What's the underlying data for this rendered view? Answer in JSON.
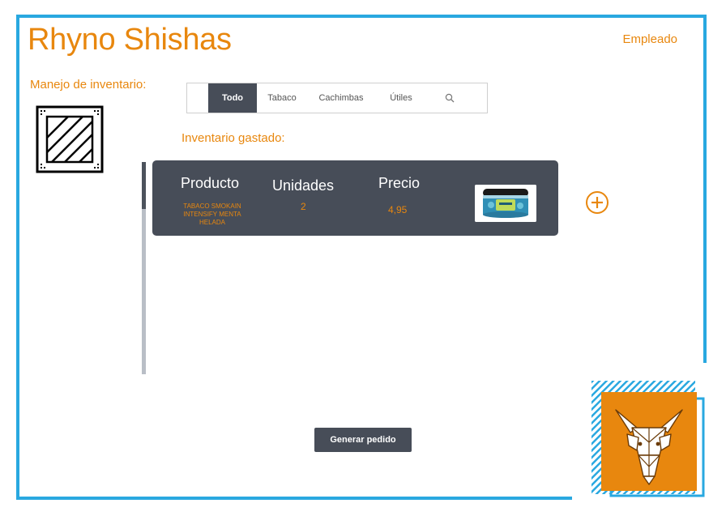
{
  "header": {
    "app_title": "Rhyno Shishas",
    "user_role": "Empleado"
  },
  "sidebar": {
    "section_title": "Manejo de inventario:",
    "icon": "crate-icon"
  },
  "tabs": [
    {
      "label": "Todo",
      "active": true
    },
    {
      "label": "Tabaco",
      "active": false
    },
    {
      "label": "Cachimbas",
      "active": false
    },
    {
      "label": "Útiles",
      "active": false
    }
  ],
  "search_icon": "search-icon",
  "inventory": {
    "title": "Inventario gastado:",
    "columns": {
      "product": "Producto",
      "units": "Unidades",
      "price": "Precio"
    },
    "items": [
      {
        "product": "TABACO SMOKAIN INTENSIFY MENTA HELADA",
        "units": "2",
        "price": "4,95",
        "image": "tobacco-tin"
      }
    ]
  },
  "actions": {
    "add_icon": "plus-circle-icon",
    "generate_label": "Generar pedido"
  },
  "colors": {
    "accent": "#e8870e",
    "frame": "#29a8e0",
    "dark": "#474d58"
  }
}
